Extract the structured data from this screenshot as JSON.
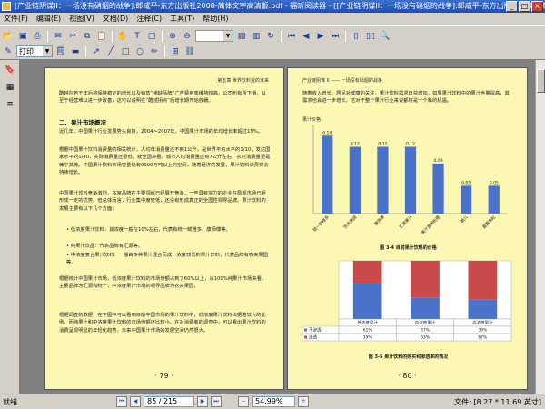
{
  "window": {
    "title": "[产业链阴谋II：一场没有硝烟的战争].郎咸平-东方出版社2008-简体文字高清版.pdf - 福昕阅读器 - [[产业链阴谋II：一场没有硝烟的战争].郎咸平-东方出版社2008-简"
  },
  "menu": [
    "文件(F)",
    "编辑(E)",
    "视图(V)",
    "文档(D)",
    "注释(C)",
    "工具(T)",
    "帮助(H)"
  ],
  "toolbar": {
    "tool_label": "打印"
  },
  "left_page": {
    "header": "第五章  世界饮料业的未来",
    "intro": "酷越在若干年后将保持稳定的增长以及销售“稀缺品牌”广告费用率维持较高，公司也有所下滑，以至于经营难以进一步改善，这可以说明在“酷越拐点”后增长期开始放缓。",
    "section_title": "二、果汁市场概况",
    "p1": "近几年，中国果汁行业发展势头良好，2004～2007年，中国果汁市场的年均增长率超过15%。",
    "p2": "根据中国果汁饮料消费量的相关统计，人均年消费量还不到1公升，是世界平均水平的1/10，发达国家水平的1/40，实际消费量还很低。就全国来看，城市人均消费量还有7公升左右，农村消费量更是微乎其微。中国果汁饮料市场容量仍有9000万吨以上的空间，随着经济的发展，果汁饮料消费将会持续增长。",
    "p3": "中国果汁饮料竞争激烈，多家品牌在主要领域已经展开竞争，一些具有实力的企业在局部市场已经形成一定的优势。但总体而言，行业集中度较低，还没有形成真正的全国性领导品牌。果汁饮料的发展主要有以下几个方面：",
    "bullets": [
      "低浓度果汁饮料：其浓度一般在10%左右，代表有统一鲜橙多、康师傅等。",
      "纯果汁饮品：代表品牌有汇源等。",
      "中浓度复合果汁饮料：一般由多种果汁混合而成，浓度较低的果汁饮料，代表品牌有农夫果园等。"
    ],
    "p4": "根据统计中国果汁市场，低浓度果汁饮料的市场份额占到了60%以上，从100%纯果汁市场来看，主要品牌为汇源和统一，中浓度果汁市场的领导品牌为农夫果园。",
    "p5": "根据调查的数据，在下图中可以看到目前中国市场的果汁饮料中，低浓度果汁饮料占据着较大的比例，而纯果汁和中浓度果汁饮料的市场份额还比较小。在对消费者的调查中，可以看出果汁饮料的消费呈现明显的年轻化趋势，未来中国果汁市场的发展空间仍然很大。",
    "page_number": "· 79 ·"
  },
  "right_page": {
    "header": "产业链阴谋 II —— 一场没有硝烟的战争",
    "intro": "随着收入增长，居民对健康的关注，果汁饮料需求日益增加，如果果汁饮料中的果汁含量提高，其需求也会进一步增长，这对于整个果汁行业来说都将是一个新的机遇。",
    "figure1_caption": "图 3-4  目前果汁饮料的价格",
    "figure2_caption": "图 3-5  果汁饮料的购买和渗透率的情况",
    "page_number": "· 80 ·"
  },
  "chart_data": [
    {
      "type": "bar",
      "title": "",
      "ylabel": "果汁价格",
      "categories": [
        "统一鲜橙多",
        "农夫果园",
        "康师傅",
        "汇源果汁",
        "美汁源果粒橙",
        "酷儿",
        "露露果粒"
      ],
      "values": [
        0.14,
        0.12,
        0.12,
        0.12,
        0.09,
        0.05,
        0.05
      ],
      "value_labels": [
        "0.14",
        "0.12",
        "0.12",
        "0.12",
        "0.09",
        "0.05",
        "0.05"
      ],
      "ylim": [
        0,
        0.16
      ],
      "color": "#4a72c8"
    },
    {
      "type": "bar",
      "stacked": true,
      "categories": [
        "低浓度果汁",
        "中浓度果汁",
        "高浓度果汁"
      ],
      "series": [
        {
          "name": "不渗透",
          "values": [
            61,
            37,
            33
          ],
          "color": "#4a72c8"
        },
        {
          "name": "渗透",
          "values": [
            39,
            63,
            67
          ],
          "color": "#c84a4a"
        }
      ],
      "ylim": [
        0,
        100
      ]
    }
  ],
  "status": {
    "ready": "就绪",
    "page_field": "85 / 215",
    "zoom": "54.99%",
    "page_size": "文件: [8.27 * 11.69 英寸]"
  },
  "colors": {
    "page_bg": "#fbf8b3",
    "viewer_bg": "#808080",
    "title_bg": "#1c4fb0"
  }
}
